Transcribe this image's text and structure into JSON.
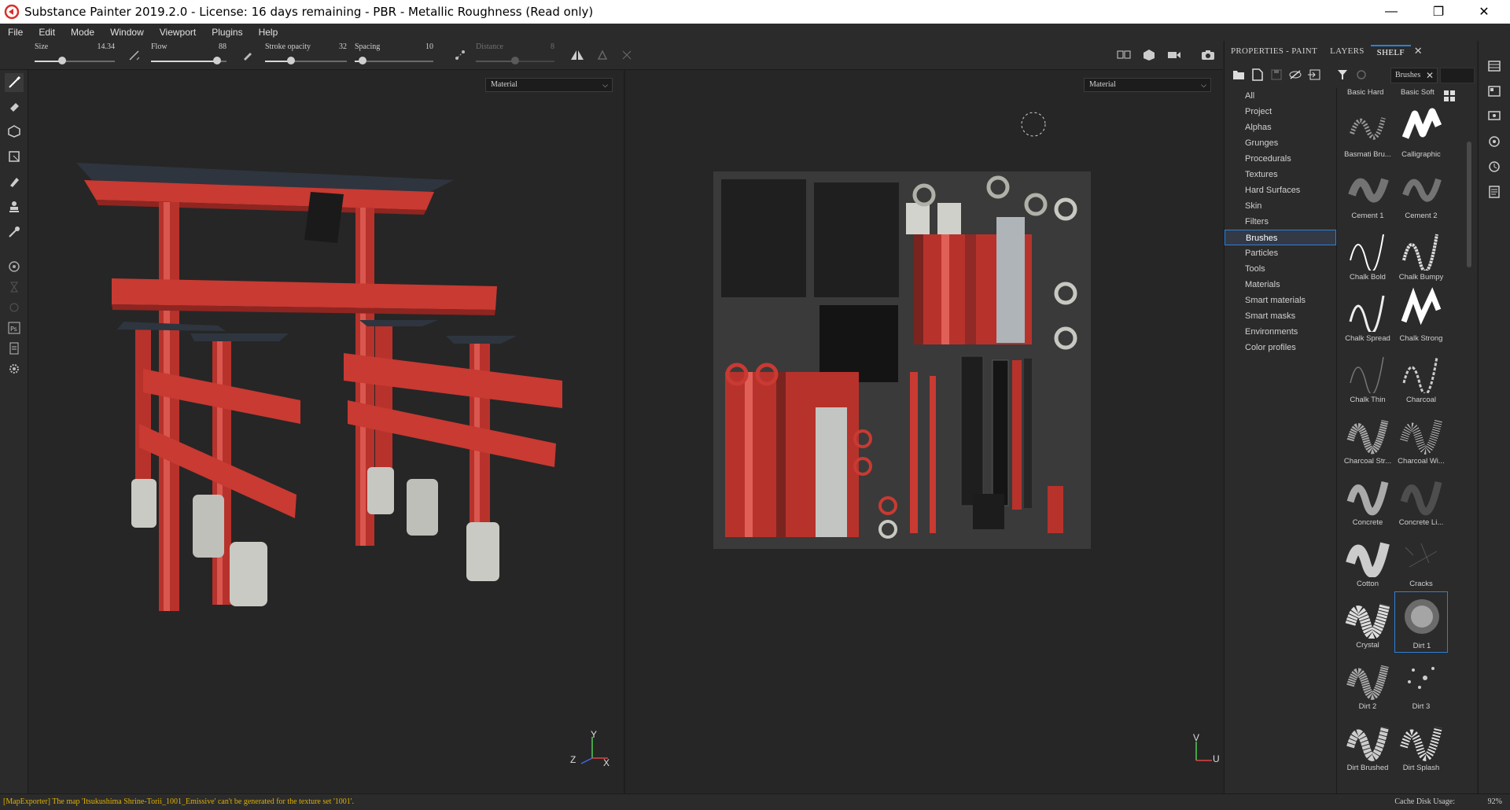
{
  "window": {
    "title": "Substance Painter 2019.2.0 - License: 16 days remaining - PBR - Metallic Roughness (Read only)",
    "controls": [
      "minimize-icon",
      "restore-icon",
      "close-icon"
    ]
  },
  "menu": [
    "File",
    "Edit",
    "Mode",
    "Window",
    "Viewport",
    "Plugins",
    "Help"
  ],
  "tool_params": {
    "size": {
      "label": "Size",
      "value": "14.34",
      "fraction": 0.34
    },
    "flow": {
      "label": "Flow",
      "value": "88",
      "fraction": 0.88
    },
    "stroke_opacity": {
      "label": "Stroke opacity",
      "value": "32",
      "fraction": 0.32
    },
    "spacing": {
      "label": "Spacing",
      "value": "10",
      "fraction": 0.1
    },
    "distance": {
      "label": "Distance",
      "value": "8",
      "fraction": 0.5
    }
  },
  "viewports": {
    "left_channel": "Material",
    "right_channel": "Material",
    "left_gizmo": {
      "y": "Y",
      "z": "Z",
      "x": "X"
    },
    "right_gizmo": {
      "v": "V",
      "u": "U"
    }
  },
  "panel_tabs": [
    "PROPERTIES - PAINT",
    "LAYERS",
    "SHELF"
  ],
  "shelf": {
    "filter_chip": "Brushes",
    "categories": [
      "All",
      "Project",
      "Alphas",
      "Grunges",
      "Procedurals",
      "Textures",
      "Hard Surfaces",
      "Skin",
      "Filters",
      "Brushes",
      "Particles",
      "Tools",
      "Materials",
      "Smart materials",
      "Smart masks",
      "Environments",
      "Color profiles"
    ],
    "selected_category": "Brushes",
    "header_items": [
      "Basic Hard",
      "Basic Soft"
    ],
    "items": [
      "Basmati Bru...",
      "Calligraphic",
      "Cement 1",
      "Cement 2",
      "Chalk Bold",
      "Chalk Bumpy",
      "Chalk Spread",
      "Chalk Strong",
      "Chalk Thin",
      "Charcoal",
      "Charcoal Str...",
      "Charcoal Wi...",
      "Concrete",
      "Concrete Li...",
      "Cotton",
      "Cracks",
      "Crystal",
      "Dirt 1",
      "Dirt 2",
      "Dirt 3",
      "Dirt Brushed",
      "Dirt Splash"
    ],
    "selected_item": "Dirt 1"
  },
  "status": {
    "message": "[MapExporter] The map 'Itsukushima Shrine-Torii_1001_Emissive' can't be generated for the texture set '1001'.",
    "cache_label": "Cache Disk Usage:",
    "cache_value": "92%"
  },
  "colors": {
    "accent": "#2f7fd6",
    "warning": "#e0b000",
    "torii_red": "#c83a32"
  }
}
